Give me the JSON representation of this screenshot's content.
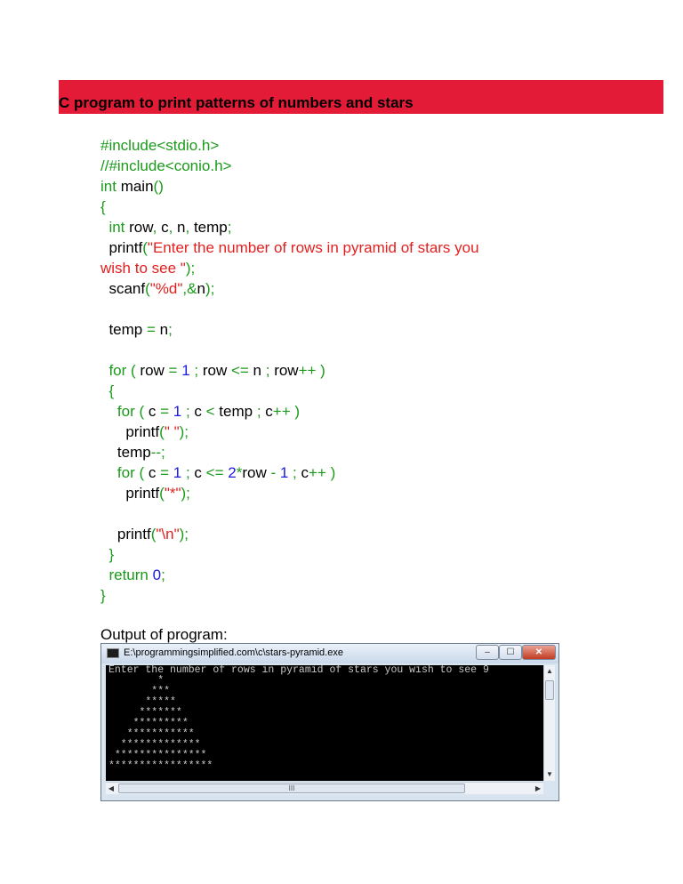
{
  "heading": "C program to print patterns of numbers and stars",
  "code_lines": [
    [
      {
        "t": "#include<stdio.h>",
        "c": "k"
      }
    ],
    [
      {
        "t": "//#include<conio.h>",
        "c": "k"
      }
    ],
    [
      {
        "t": "int",
        "c": "k"
      },
      {
        "t": " main"
      },
      {
        "t": "()",
        "c": "k"
      }
    ],
    [
      {
        "t": "{",
        "c": "k"
      }
    ],
    [
      {
        "t": "  "
      },
      {
        "t": "int",
        "c": "k"
      },
      {
        "t": " row"
      },
      {
        "t": ",",
        "c": "k"
      },
      {
        "t": " c"
      },
      {
        "t": ",",
        "c": "k"
      },
      {
        "t": " n"
      },
      {
        "t": ",",
        "c": "k"
      },
      {
        "t": " temp"
      },
      {
        "t": ";",
        "c": "k"
      }
    ],
    [
      {
        "t": "  printf"
      },
      {
        "t": "(",
        "c": "k"
      },
      {
        "t": "\"Enter the number of rows in pyramid of stars you",
        "c": "s"
      }
    ],
    [
      {
        "t": "wish to see \"",
        "c": "s"
      },
      {
        "t": ");",
        "c": "k"
      }
    ],
    [
      {
        "t": "  scanf"
      },
      {
        "t": "(",
        "c": "k"
      },
      {
        "t": "\"%d\"",
        "c": "s"
      },
      {
        "t": ",",
        "c": "k"
      },
      {
        "t": "&",
        "c": "k"
      },
      {
        "t": "n"
      },
      {
        "t": ");",
        "c": "k"
      }
    ],
    [],
    [
      {
        "t": "  temp "
      },
      {
        "t": "=",
        "c": "k"
      },
      {
        "t": " n"
      },
      {
        "t": ";",
        "c": "k"
      }
    ],
    [],
    [
      {
        "t": "  "
      },
      {
        "t": "for",
        "c": "k"
      },
      {
        "t": " ( ",
        "c": "k"
      },
      {
        "t": "row "
      },
      {
        "t": "=",
        "c": "k"
      },
      {
        "t": " "
      },
      {
        "t": "1",
        "c": "n"
      },
      {
        "t": " ; ",
        "c": "k"
      },
      {
        "t": "row "
      },
      {
        "t": "<=",
        "c": "k"
      },
      {
        "t": " n "
      },
      {
        "t": ";",
        "c": "k"
      },
      {
        "t": " row"
      },
      {
        "t": "++ )",
        "c": "k"
      }
    ],
    [
      {
        "t": "  "
      },
      {
        "t": "{",
        "c": "k"
      }
    ],
    [
      {
        "t": "    "
      },
      {
        "t": "for",
        "c": "k"
      },
      {
        "t": " ( ",
        "c": "k"
      },
      {
        "t": "c "
      },
      {
        "t": "=",
        "c": "k"
      },
      {
        "t": " "
      },
      {
        "t": "1",
        "c": "n"
      },
      {
        "t": " ; ",
        "c": "k"
      },
      {
        "t": "c "
      },
      {
        "t": "<",
        "c": "k"
      },
      {
        "t": " temp "
      },
      {
        "t": ";",
        "c": "k"
      },
      {
        "t": " c"
      },
      {
        "t": "++ )",
        "c": "k"
      }
    ],
    [
      {
        "t": "      printf"
      },
      {
        "t": "(",
        "c": "k"
      },
      {
        "t": "\" \"",
        "c": "s"
      },
      {
        "t": ");",
        "c": "k"
      }
    ],
    [
      {
        "t": "    temp"
      },
      {
        "t": "--;",
        "c": "k"
      }
    ],
    [
      {
        "t": "    "
      },
      {
        "t": "for",
        "c": "k"
      },
      {
        "t": " ( ",
        "c": "k"
      },
      {
        "t": "c "
      },
      {
        "t": "=",
        "c": "k"
      },
      {
        "t": " "
      },
      {
        "t": "1",
        "c": "n"
      },
      {
        "t": " ; ",
        "c": "k"
      },
      {
        "t": "c "
      },
      {
        "t": "<=",
        "c": "k"
      },
      {
        "t": " "
      },
      {
        "t": "2",
        "c": "n"
      },
      {
        "t": "*",
        "c": "k"
      },
      {
        "t": "row "
      },
      {
        "t": "-",
        "c": "k"
      },
      {
        "t": " "
      },
      {
        "t": "1",
        "c": "n"
      },
      {
        "t": " ; ",
        "c": "k"
      },
      {
        "t": "c"
      },
      {
        "t": "++ )",
        "c": "k"
      }
    ],
    [
      {
        "t": "      printf"
      },
      {
        "t": "(",
        "c": "k"
      },
      {
        "t": "\"*\"",
        "c": "s"
      },
      {
        "t": ");",
        "c": "k"
      }
    ],
    [],
    [
      {
        "t": "    printf"
      },
      {
        "t": "(",
        "c": "k"
      },
      {
        "t": "\"\\n\"",
        "c": "s"
      },
      {
        "t": ");",
        "c": "k"
      }
    ],
    [
      {
        "t": "  "
      },
      {
        "t": "}",
        "c": "k"
      }
    ],
    [
      {
        "t": "  "
      },
      {
        "t": "return",
        "c": "k"
      },
      {
        "t": " "
      },
      {
        "t": "0",
        "c": "n"
      },
      {
        "t": ";",
        "c": "k"
      }
    ],
    [
      {
        "t": "}",
        "c": "k"
      }
    ]
  ],
  "output_label": "Output of program:",
  "console": {
    "title": "E:\\programmingsimplified.com\\c\\stars-pyramid.exe",
    "minimize": "–",
    "maximize": "☐",
    "close": "✕",
    "lines": [
      "Enter the number of rows in pyramid of stars you wish to see 9",
      "        *",
      "       ***",
      "      *****",
      "     *******",
      "    *********",
      "   ***********",
      "  *************",
      " ***************",
      "*****************"
    ],
    "scroll_grip": "III"
  }
}
